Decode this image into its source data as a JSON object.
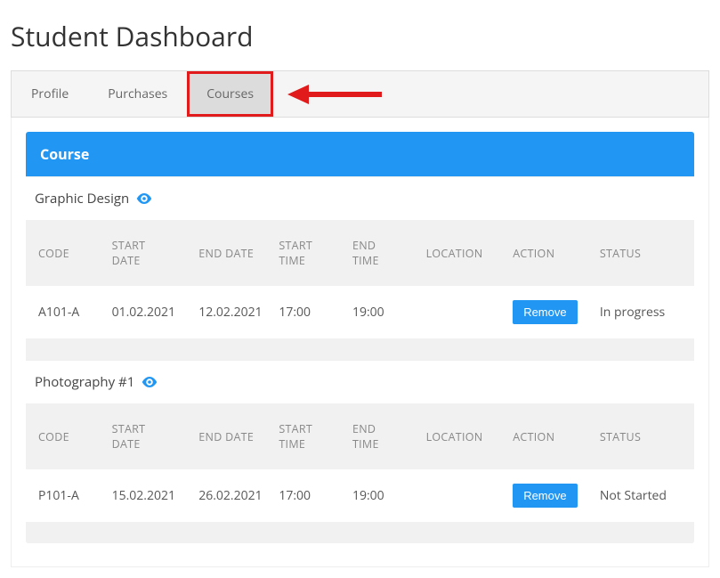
{
  "page_title": "Student Dashboard",
  "tabs": {
    "profile": "Profile",
    "purchases": "Purchases",
    "courses": "Courses"
  },
  "panel_title": "Course",
  "columns": {
    "code": "CODE",
    "start_date": "START DATE",
    "end_date": "END DATE",
    "start_time": "START TIME",
    "end_time": "END TIME",
    "location": "LOCATION",
    "action": "ACTION",
    "status": "STATUS"
  },
  "courses": [
    {
      "name": "Graphic Design",
      "code": "A101-A",
      "start_date": "01.02.2021",
      "end_date": "12.02.2021",
      "start_time": "17:00",
      "end_time": "19:00",
      "location": "",
      "action_label": "Remove",
      "status": "In progress"
    },
    {
      "name": "Photography #1",
      "code": "P101-A",
      "start_date": "15.02.2021",
      "end_date": "26.02.2021",
      "start_time": "17:00",
      "end_time": "19:00",
      "location": "",
      "action_label": "Remove",
      "status": "Not Started"
    }
  ],
  "annotation": {
    "highlight_color": "#e11b1b",
    "arrow_color": "#e11b1b"
  }
}
